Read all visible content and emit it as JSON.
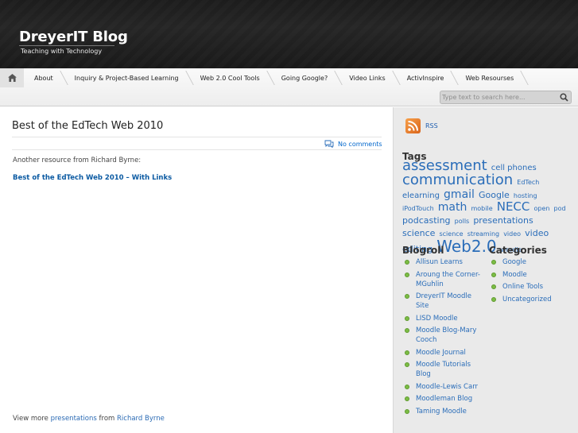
{
  "header": {
    "title": "DreyerIT Blog",
    "tagline": "Teaching with Technology"
  },
  "nav": {
    "home_icon": "home-icon",
    "items": [
      {
        "label": "About"
      },
      {
        "label": "Inquiry & Project-Based Learning"
      },
      {
        "label": "Web 2.0 Cool Tools"
      },
      {
        "label": "Going Google?"
      },
      {
        "label": "Video Links"
      },
      {
        "label": "ActivInspire"
      },
      {
        "label": "Web Resourses"
      }
    ],
    "search_placeholder": "Type text to search here...",
    "search_icon": "search-icon"
  },
  "post": {
    "title": "Best of the EdTech Web 2010",
    "comments": "No comments",
    "intro": "Another resource from Richard Byrne:",
    "link": "Best of the EdTech Web 2010 – With Links",
    "view_more_prefix": "View more ",
    "view_more_link1": "presentations",
    "view_more_mid": " from ",
    "view_more_link2": "Richard Byrne"
  },
  "sidebar": {
    "rss_label": "RSS",
    "tags_heading": "Tags",
    "tags": [
      {
        "text": "assessment",
        "size": 18
      },
      {
        "text": "cell phones",
        "size": 10
      },
      {
        "text": "communication",
        "size": 18
      },
      {
        "text": "EdTech",
        "size": 8
      },
      {
        "text": "elearning",
        "size": 10
      },
      {
        "text": "gmail",
        "size": 14
      },
      {
        "text": "Google",
        "size": 11
      },
      {
        "text": "hosting",
        "size": 8
      },
      {
        "text": "iPodTouch",
        "size": 8
      },
      {
        "text": "math",
        "size": 14
      },
      {
        "text": "mobile",
        "size": 8
      },
      {
        "text": "NECC",
        "size": 15
      },
      {
        "text": "open",
        "size": 8
      },
      {
        "text": "pod",
        "size": 8
      },
      {
        "text": "podcasting",
        "size": 11
      },
      {
        "text": "polls",
        "size": 8
      },
      {
        "text": "presentations",
        "size": 11
      },
      {
        "text": "science",
        "size": 11
      },
      {
        "text": "science",
        "size": 8
      },
      {
        "text": "streaming",
        "size": 8
      },
      {
        "text": "video",
        "size": 8
      },
      {
        "text": "video editing",
        "size": 11
      },
      {
        "text": "Web2.0",
        "size": 20
      },
      {
        "text": "wordle",
        "size": 8
      }
    ],
    "blogroll_heading": "Blogroll",
    "blogroll": [
      "Allisun Learns",
      "Aroung the Corner-MGuhlin",
      "DreyerIT Moodle Site",
      "LISD Moodle",
      "Moodle Blog-Mary Cooch",
      "Moodle Journal",
      "Moodle Tutorials Blog",
      "Moodle-Lewis Carr",
      "Moodleman Blog",
      "Taming Moodle"
    ],
    "categories_heading": "Categories",
    "categories": [
      "Google",
      "Moodle",
      "Online Tools",
      "Uncategorized"
    ]
  }
}
